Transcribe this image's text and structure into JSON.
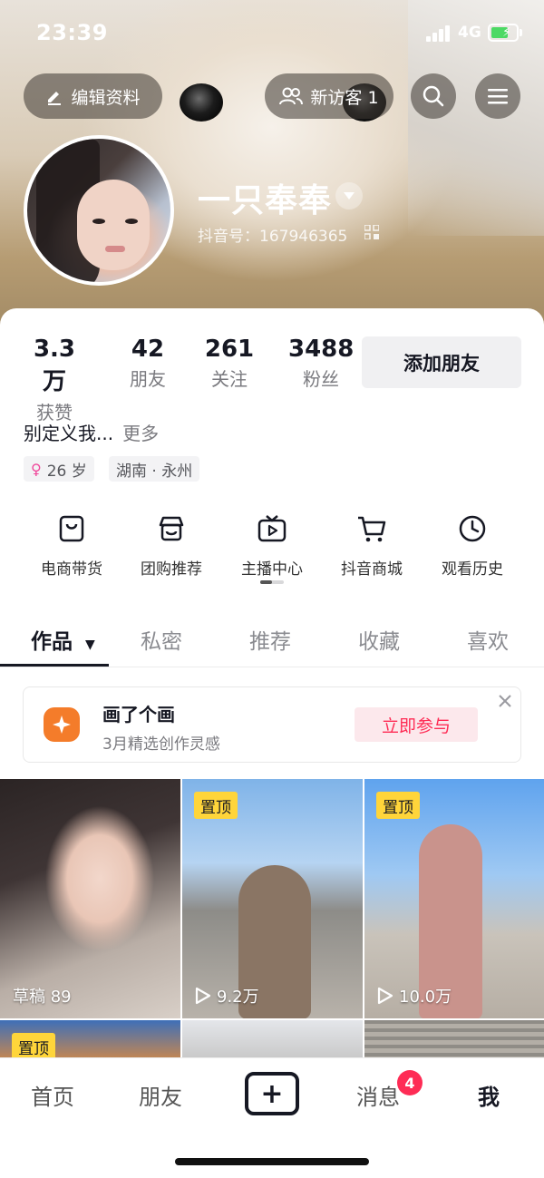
{
  "status_bar": {
    "time": "23:39",
    "network": "4G"
  },
  "top_bar": {
    "edit_profile": "编辑资料",
    "new_visitors": "新访客 1"
  },
  "profile": {
    "name": "一只奉奉",
    "douyin_id": "抖音号：167946365"
  },
  "stats": [
    {
      "value": "3.3万",
      "label": "获赞"
    },
    {
      "value": "42",
      "label": "朋友"
    },
    {
      "value": "261",
      "label": "关注"
    },
    {
      "value": "3488",
      "label": "粉丝"
    }
  ],
  "add_friend": "添加朋友",
  "bio": {
    "text": "别定义我...",
    "more": "更多"
  },
  "tags": {
    "age": "26 岁",
    "location": "湖南 · 永州"
  },
  "services": [
    {
      "label": "电商带货",
      "icon": "bag-icon"
    },
    {
      "label": "团购推荐",
      "icon": "shop-icon"
    },
    {
      "label": "主播中心",
      "icon": "tv-icon"
    },
    {
      "label": "抖音商城",
      "icon": "cart-icon"
    },
    {
      "label": "观看历史",
      "icon": "clock-icon"
    }
  ],
  "tabs": [
    "作品",
    "私密",
    "推荐",
    "收藏",
    "喜欢"
  ],
  "promo": {
    "title": "画了个画",
    "subtitle": "3月精选创作灵感",
    "button": "立即参与"
  },
  "videos": [
    {
      "label": "草稿 89",
      "pinned": ""
    },
    {
      "label": "9.2万",
      "pinned": "置顶"
    },
    {
      "label": "10.0万",
      "pinned": "置顶"
    },
    {
      "label": "",
      "pinned": "置顶"
    }
  ],
  "nav": {
    "home": "首页",
    "friends": "朋友",
    "messages": "消息",
    "messages_badge": "4",
    "me": "我"
  },
  "colors": {
    "accent": "#fe2c55",
    "pin": "#ffd53a",
    "promo_icon": "#f47c2a"
  }
}
